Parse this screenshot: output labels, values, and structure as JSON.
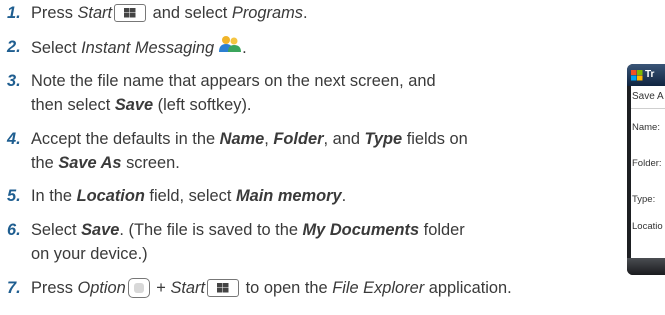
{
  "steps": [
    {
      "num": "1.",
      "parts": [
        {
          "t": "Press ",
          "s": "n"
        },
        {
          "t": "Start",
          "s": "em"
        },
        {
          "k": "start-key"
        },
        {
          "t": " and select ",
          "s": "n"
        },
        {
          "t": "Programs",
          "s": "em"
        },
        {
          "t": ".",
          "s": "n"
        }
      ]
    },
    {
      "num": "2.",
      "parts": [
        {
          "t": "Select ",
          "s": "n"
        },
        {
          "t": "Instant Messaging",
          "s": "em"
        },
        {
          "k": "im-icon"
        },
        {
          "t": ".",
          "s": "n"
        }
      ]
    },
    {
      "num": "3.",
      "lines": [
        [
          {
            "t": "Note the file name that appears on the next screen, and",
            "s": "n"
          }
        ],
        [
          {
            "t": "then select ",
            "s": "n"
          },
          {
            "t": "Save",
            "s": "b"
          },
          {
            "t": " (left softkey).",
            "s": "n"
          }
        ]
      ]
    },
    {
      "num": "4.",
      "lines": [
        [
          {
            "t": "Accept the defaults in the ",
            "s": "n"
          },
          {
            "t": "Name",
            "s": "b"
          },
          {
            "t": ", ",
            "s": "n"
          },
          {
            "t": "Folder",
            "s": "b"
          },
          {
            "t": ", and ",
            "s": "n"
          },
          {
            "t": "Type",
            "s": "b"
          },
          {
            "t": " fields on",
            "s": "n"
          }
        ],
        [
          {
            "t": "the ",
            "s": "n"
          },
          {
            "t": "Save As",
            "s": "b"
          },
          {
            "t": " screen.",
            "s": "n"
          }
        ]
      ]
    },
    {
      "num": "5.",
      "parts": [
        {
          "t": "In the ",
          "s": "n"
        },
        {
          "t": "Location",
          "s": "b"
        },
        {
          "t": " field, select ",
          "s": "n"
        },
        {
          "t": "Main memory",
          "s": "b"
        },
        {
          "t": ".",
          "s": "n"
        }
      ]
    },
    {
      "num": "6.",
      "lines": [
        [
          {
            "t": "Select ",
            "s": "n"
          },
          {
            "t": "Save",
            "s": "b"
          },
          {
            "t": ". (The file is saved to the ",
            "s": "n"
          },
          {
            "t": "My Documents",
            "s": "b"
          },
          {
            "t": " folder",
            "s": "n"
          }
        ],
        [
          {
            "t": "on your device.)",
            "s": "n"
          }
        ]
      ]
    },
    {
      "num": "7.",
      "parts": [
        {
          "t": "Press ",
          "s": "n"
        },
        {
          "t": "Option",
          "s": "em"
        },
        {
          "k": "option-key"
        },
        {
          "t": " + ",
          "s": "n"
        },
        {
          "t": "Start",
          "s": "em"
        },
        {
          "k": "start-key"
        },
        {
          "t": " to open the ",
          "s": "n"
        },
        {
          "t": "File Explorer",
          "s": "em"
        },
        {
          "t": " application.",
          "s": "n"
        }
      ]
    }
  ],
  "device": {
    "title": "Tr",
    "header": "Save A",
    "fields": [
      "Name:",
      "Folder:",
      "Type:",
      "Locatio"
    ],
    "icon": "windows-flag-icon",
    "colors": {
      "titlebar": "#1a3458",
      "accent": "#1f5e90"
    }
  }
}
